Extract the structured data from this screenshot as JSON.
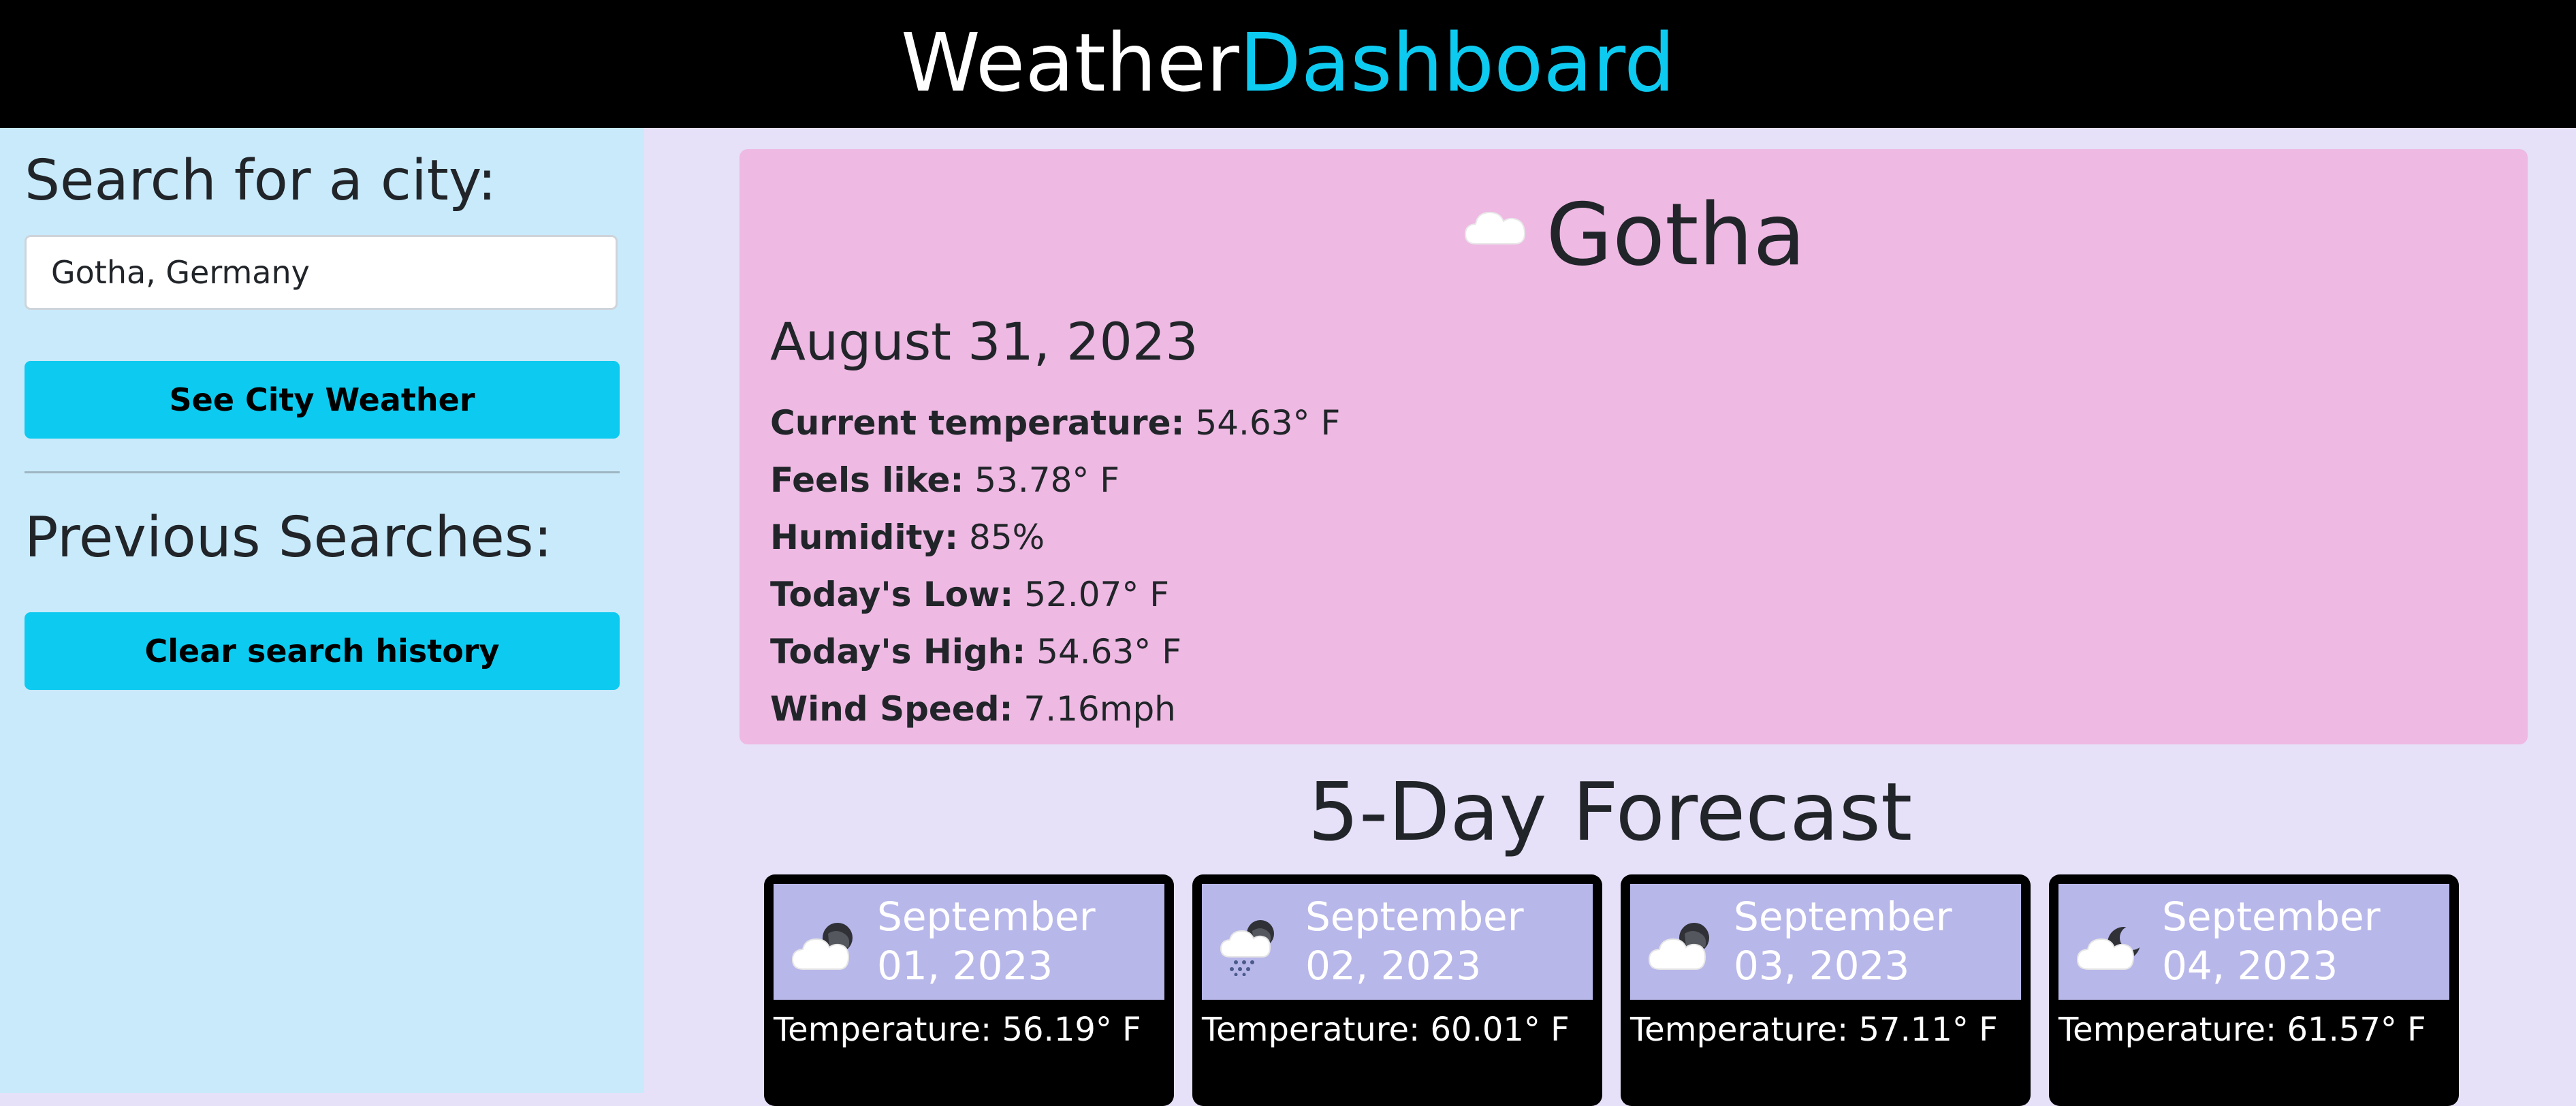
{
  "header": {
    "title_part1": "Weather",
    "title_part2": "Dashboard"
  },
  "sidebar": {
    "search_heading": "Search for a city:",
    "search_value": "Gotha, Germany",
    "see_button": "See City Weather",
    "previous_heading": "Previous Searches:",
    "clear_button": "Clear search history"
  },
  "current": {
    "icon": "cloud-icon",
    "city": "Gotha",
    "date": "August 31, 2023",
    "stats": [
      {
        "label": "Current temperature:",
        "value": "54.63° F"
      },
      {
        "label": "Feels like:",
        "value": "53.78° F"
      },
      {
        "label": "Humidity:",
        "value": "85%"
      },
      {
        "label": "Today's Low:",
        "value": "52.07° F"
      },
      {
        "label": "Today's High:",
        "value": "54.63° F"
      },
      {
        "label": "Wind Speed:",
        "value": "7.16mph"
      }
    ]
  },
  "forecast": {
    "title": "5-Day Forecast",
    "days": [
      {
        "icon": "night-cloudy-icon",
        "date_line1": "September",
        "date_line2": "01, 2023",
        "temperature": "Temperature: 56.19° F"
      },
      {
        "icon": "night-rain-icon",
        "date_line1": "September",
        "date_line2": "02, 2023",
        "temperature": "Temperature: 60.01° F"
      },
      {
        "icon": "night-cloudy-icon",
        "date_line1": "September",
        "date_line2": "03, 2023",
        "temperature": "Temperature: 57.11° F"
      },
      {
        "icon": "night-partly-cloudy-icon",
        "date_line1": "September",
        "date_line2": "04, 2023",
        "temperature": "Temperature: 61.57° F"
      }
    ]
  },
  "colors": {
    "header_bg": "#000000",
    "accent": "#0dcaf0",
    "sidebar_bg": "#c8eafb",
    "main_bg": "#e6e0f8",
    "current_card_bg": "#eeb9e3",
    "forecast_header_bg": "#b8b7ea"
  }
}
